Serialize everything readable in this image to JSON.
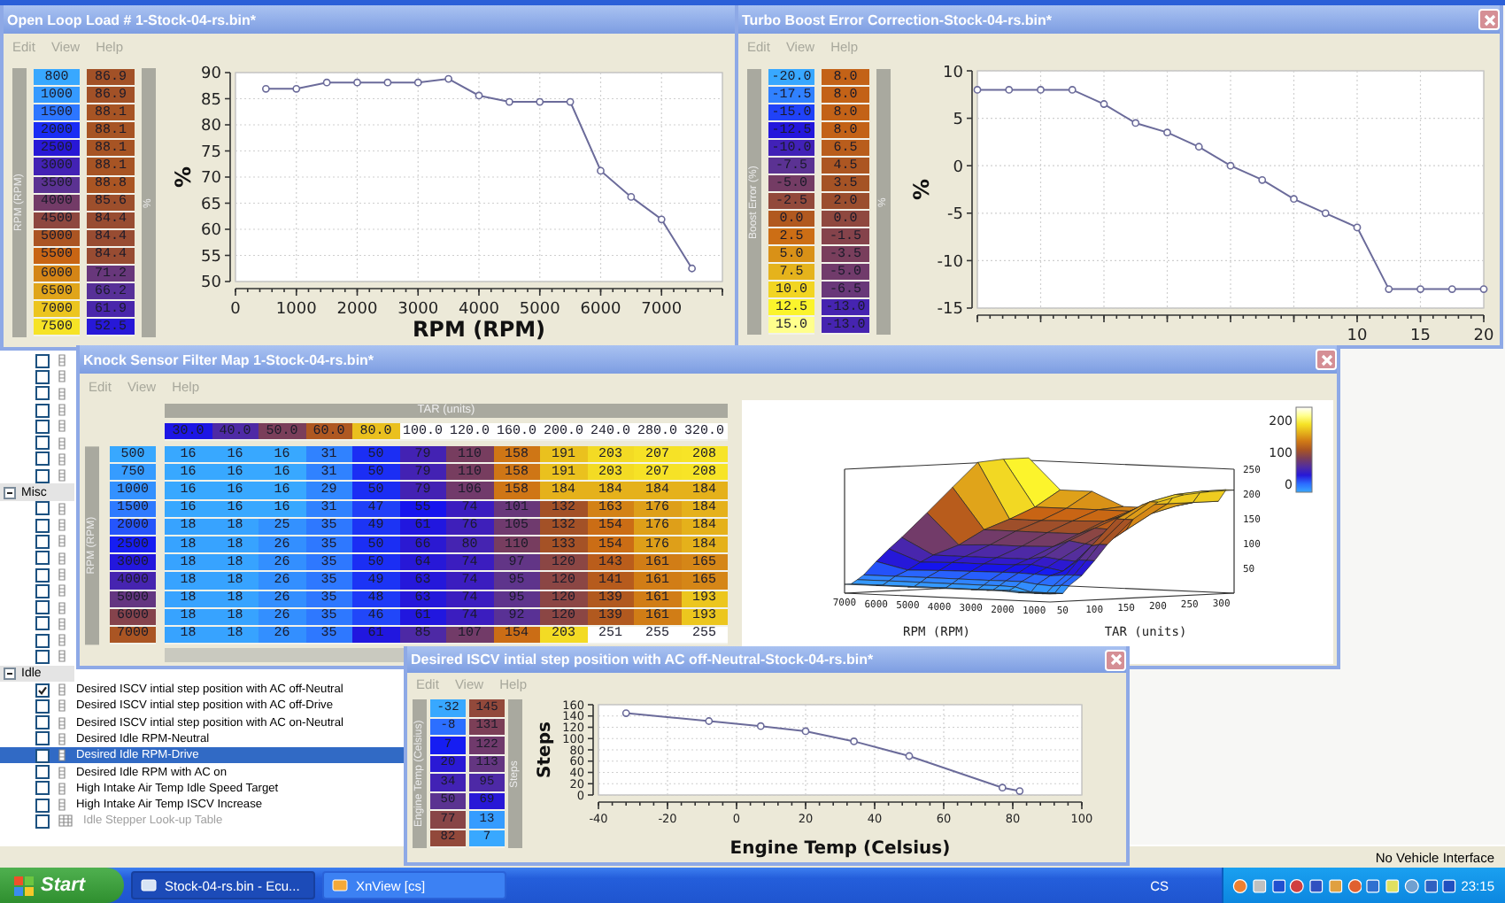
{
  "tree": [
    {
      "kind": "rows",
      "items": [
        {
          "kind": "curve",
          "checked": false
        },
        {
          "kind": "curve",
          "checked": false
        },
        {
          "kind": "curve",
          "checked": false
        },
        {
          "kind": "curve",
          "checked": false
        },
        {
          "kind": "curve",
          "checked": false
        },
        {
          "kind": "curve",
          "checked": false
        },
        {
          "kind": "curve",
          "checked": false
        },
        {
          "kind": "curve",
          "checked": false
        }
      ]
    },
    {
      "kind": "group",
      "label": "Misc",
      "expanded": true,
      "items": [
        {
          "kind": "curve",
          "checked": false
        },
        {
          "kind": "curve",
          "checked": false
        },
        {
          "kind": "curve",
          "checked": false
        },
        {
          "kind": "curve",
          "checked": false
        },
        {
          "kind": "curve",
          "checked": false
        },
        {
          "kind": "curve",
          "checked": false
        },
        {
          "kind": "curve",
          "checked": false
        },
        {
          "kind": "curve",
          "checked": false
        },
        {
          "kind": "curve",
          "checked": false
        },
        {
          "kind": "curve",
          "checked": false
        }
      ]
    },
    {
      "kind": "group",
      "label": "Idle",
      "expanded": true,
      "items": [
        {
          "kind": "curve",
          "label": "Desired ISCV intial step position with AC off-Neutral",
          "checked": true,
          "selected": false,
          "disabled": false
        },
        {
          "kind": "curve",
          "label": "Desired ISCV intial step position with AC off-Drive",
          "checked": false,
          "selected": false,
          "disabled": false
        },
        {
          "kind": "curve",
          "label": "Desired ISCV intial step position with AC on-Neutral",
          "checked": false,
          "selected": false,
          "disabled": false
        },
        {
          "kind": "curve",
          "label": "Desired Idle RPM-Neutral",
          "checked": false,
          "selected": false,
          "disabled": false
        },
        {
          "kind": "curve",
          "label": "Desired Idle RPM-Drive",
          "checked": false,
          "selected": true,
          "disabled": false
        },
        {
          "kind": "curve",
          "label": "Desired Idle RPM with AC on",
          "checked": false,
          "selected": false,
          "disabled": false
        },
        {
          "kind": "curve",
          "label": "High Intake Air Temp Idle Speed Target",
          "checked": false,
          "selected": false,
          "disabled": false
        },
        {
          "kind": "curve",
          "label": "High Intake Air Temp ISCV Increase",
          "checked": false,
          "selected": false,
          "disabled": false
        },
        {
          "kind": "map",
          "label": "Idle Stepper Look-up Table",
          "checked": false,
          "selected": false,
          "disabled": true
        }
      ]
    }
  ],
  "windows": [
    {
      "kind": "curve",
      "title": "Open Loop Load # 1-Stock-04-rs.bin*",
      "close_button": false,
      "menu": [
        {
          "label": "Edit",
          "disabled": true
        },
        {
          "label": "View",
          "disabled": true
        },
        {
          "label": "Help",
          "disabled": true
        }
      ],
      "axis_label": "RPM (RPM)",
      "value_label": "%",
      "rows": [
        {
          "axis": "800",
          "value": "86.9"
        },
        {
          "axis": "1000",
          "value": "86.9"
        },
        {
          "axis": "1500",
          "value": "88.1"
        },
        {
          "axis": "2000",
          "value": "88.1"
        },
        {
          "axis": "2500",
          "value": "88.1"
        },
        {
          "axis": "3000",
          "value": "88.1"
        },
        {
          "axis": "3500",
          "value": "88.8"
        },
        {
          "axis": "4000",
          "value": "85.6"
        },
        {
          "axis": "4500",
          "value": "84.4"
        },
        {
          "axis": "5000",
          "value": "84.4"
        },
        {
          "axis": "5500",
          "value": "84.4"
        },
        {
          "axis": "6000",
          "value": "71.2"
        },
        {
          "axis": "6500",
          "value": "66.2"
        },
        {
          "axis": "7000",
          "value": "61.9"
        },
        {
          "axis": "7500",
          "value": "52.5"
        }
      ],
      "chart_data": {
        "type": "line",
        "xlabel": "RPM (RPM)",
        "ylabel": "%",
        "x": [
          500,
          1000,
          1500,
          2000,
          2500,
          3000,
          3500,
          4000,
          4500,
          5000,
          5500,
          6000,
          6500,
          7000,
          7500
        ],
        "series": [
          {
            "color": "#6b6b9a",
            "marker": "circle",
            "values": [
              86.9,
              86.9,
              88.1,
              88.1,
              88.1,
              88.1,
              88.8,
              85.6,
              84.4,
              84.4,
              84.4,
              71.2,
              66.2,
              61.9,
              52.5
            ]
          }
        ],
        "grid": true,
        "xlim": [
          0,
          8000
        ],
        "ylim": [
          50,
          90
        ],
        "xticks": [
          {
            "value": 0,
            "label": "0"
          },
          {
            "value": 1000,
            "label": "1000"
          },
          {
            "value": 2000,
            "label": "2000"
          },
          {
            "value": 3000,
            "label": "3000"
          },
          {
            "value": 4000,
            "label": "4000"
          },
          {
            "value": 5000,
            "label": "5000"
          },
          {
            "value": 6000,
            "label": "6000"
          },
          {
            "value": 7000,
            "label": "7000"
          }
        ],
        "yticks": [
          {
            "value": 50,
            "label": "50"
          },
          {
            "value": 55,
            "label": "55"
          },
          {
            "value": 60,
            "label": "60"
          },
          {
            "value": 65,
            "label": "65"
          },
          {
            "value": 70,
            "label": "70"
          },
          {
            "value": 75,
            "label": "75"
          },
          {
            "value": 80,
            "label": "80"
          },
          {
            "value": 85,
            "label": "85"
          },
          {
            "value": 90,
            "label": "90"
          }
        ]
      }
    },
    {
      "kind": "curve",
      "title": "Turbo Boost Error Correction-Stock-04-rs.bin*",
      "close_button": true,
      "menu": [
        {
          "label": "Edit",
          "disabled": true
        },
        {
          "label": "View",
          "disabled": true
        },
        {
          "label": "Help",
          "disabled": true
        }
      ],
      "axis_label": "Boost Error (%)",
      "value_label": "%",
      "rows": [
        {
          "axis": "-20.0",
          "value": "8.0"
        },
        {
          "axis": "-17.5",
          "value": "8.0"
        },
        {
          "axis": "-15.0",
          "value": "8.0"
        },
        {
          "axis": "-12.5",
          "value": "8.0"
        },
        {
          "axis": "-10.0",
          "value": "6.5"
        },
        {
          "axis": "-7.5",
          "value": "4.5"
        },
        {
          "axis": "-5.0",
          "value": "3.5"
        },
        {
          "axis": "-2.5",
          "value": "2.0"
        },
        {
          "axis": "0.0",
          "value": "0.0"
        },
        {
          "axis": "2.5",
          "value": "-1.5"
        },
        {
          "axis": "5.0",
          "value": "-3.5"
        },
        {
          "axis": "7.5",
          "value": "-5.0"
        },
        {
          "axis": "10.0",
          "value": "-6.5"
        },
        {
          "axis": "12.5",
          "value": "-13.0"
        },
        {
          "axis": "15.0",
          "value": "-13.0"
        }
      ],
      "chart_data": {
        "type": "line",
        "ylabel": "%",
        "x": [
          -20,
          -17.5,
          -15,
          -12.5,
          -10,
          -7.5,
          -5,
          -2.5,
          0,
          2.5,
          5,
          7.5,
          10,
          12.5,
          15,
          17.5,
          20
        ],
        "series": [
          {
            "color": "#6b6b9a",
            "marker": "circle",
            "values": [
              8,
              8,
              8,
              8,
              6.5,
              4.5,
              3.5,
              2,
              0,
              -1.5,
              -3.5,
              -5,
              -6.5,
              -13,
              -13,
              -13,
              -13
            ]
          }
        ],
        "grid": true,
        "xlim": [
          -20,
          20
        ],
        "ylim": [
          -15,
          10
        ],
        "xticks": [
          {
            "value": 10,
            "label": "10"
          },
          {
            "value": 15,
            "label": "15"
          },
          {
            "value": 20,
            "label": "20"
          }
        ],
        "yticks": [
          {
            "value": -15,
            "label": "-15"
          },
          {
            "value": -10,
            "label": "-10"
          },
          {
            "value": -5,
            "label": "-5"
          },
          {
            "value": 0,
            "label": "0"
          },
          {
            "value": 5,
            "label": "5"
          },
          {
            "value": 10,
            "label": "10"
          }
        ]
      }
    },
    {
      "kind": "map",
      "title": "Knock Sensor Filter Map 1-Stock-04-rs.bin*",
      "close_button": true,
      "menu": [
        {
          "label": "Edit",
          "disabled": true
        },
        {
          "label": "View",
          "disabled": true
        },
        {
          "label": "Help",
          "disabled": true
        }
      ],
      "column_label": "TAR (units)",
      "row_label": "RPM (RPM)",
      "columns": [
        "30.0",
        "40.0",
        "50.0",
        "60.0",
        "80.0",
        "100.0",
        "120.0",
        "160.0",
        "200.0",
        "240.0",
        "280.0",
        "320.0"
      ],
      "rows": [
        {
          "axis": "500",
          "cells": [
            "16",
            "16",
            "16",
            "31",
            "50",
            "79",
            "110",
            "158",
            "191",
            "203",
            "207",
            "208"
          ]
        },
        {
          "axis": "750",
          "cells": [
            "16",
            "16",
            "16",
            "31",
            "50",
            "79",
            "110",
            "158",
            "191",
            "203",
            "207",
            "208"
          ]
        },
        {
          "axis": "1000",
          "cells": [
            "16",
            "16",
            "16",
            "29",
            "50",
            "79",
            "106",
            "158",
            "184",
            "184",
            "184",
            "184"
          ]
        },
        {
          "axis": "1500",
          "cells": [
            "16",
            "16",
            "16",
            "31",
            "47",
            "55",
            "74",
            "101",
            "132",
            "163",
            "176",
            "184"
          ]
        },
        {
          "axis": "2000",
          "cells": [
            "18",
            "18",
            "25",
            "35",
            "49",
            "61",
            "76",
            "105",
            "132",
            "154",
            "176",
            "184"
          ]
        },
        {
          "axis": "2500",
          "cells": [
            "18",
            "18",
            "26",
            "35",
            "50",
            "66",
            "80",
            "110",
            "133",
            "154",
            "176",
            "184"
          ]
        },
        {
          "axis": "3000",
          "cells": [
            "18",
            "18",
            "26",
            "35",
            "50",
            "64",
            "74",
            "97",
            "120",
            "143",
            "161",
            "165"
          ]
        },
        {
          "axis": "4000",
          "cells": [
            "18",
            "18",
            "26",
            "35",
            "49",
            "63",
            "74",
            "95",
            "120",
            "141",
            "161",
            "165"
          ]
        },
        {
          "axis": "5000",
          "cells": [
            "18",
            "18",
            "26",
            "35",
            "48",
            "63",
            "74",
            "95",
            "120",
            "139",
            "161",
            "193"
          ]
        },
        {
          "axis": "6000",
          "cells": [
            "18",
            "18",
            "26",
            "35",
            "46",
            "61",
            "74",
            "92",
            "120",
            "139",
            "161",
            "193"
          ]
        },
        {
          "axis": "7000",
          "cells": [
            "18",
            "18",
            "26",
            "35",
            "61",
            "85",
            "107",
            "154",
            "203",
            "251",
            "255",
            "255"
          ]
        }
      ],
      "surface_plot": {
        "xlabel": "RPM (RPM)",
        "ylabel": "TAR (units)",
        "x_ticks": [
          "7000",
          "6000",
          "5000",
          "4000",
          "3000",
          "2000",
          "1000"
        ],
        "y_ticks": [
          "50",
          "100",
          "150",
          "200",
          "250",
          "300"
        ],
        "z_ticks": [
          "250",
          "200",
          "150",
          "100",
          "50"
        ],
        "colorbar_ticks": [
          "200",
          "100",
          "0"
        ]
      }
    },
    {
      "kind": "curve",
      "title": "Desired ISCV intial step position with AC off-Neutral-Stock-04-rs.bin*",
      "close_button": true,
      "menu": [
        {
          "label": "Edit",
          "disabled": true
        },
        {
          "label": "View",
          "disabled": true
        },
        {
          "label": "Help",
          "disabled": true
        }
      ],
      "axis_label": "Engine Temp (Celsius)",
      "value_label": "Steps",
      "rows": [
        {
          "axis": "-32",
          "value": "145"
        },
        {
          "axis": "-8",
          "value": "131"
        },
        {
          "axis": "7",
          "value": "122"
        },
        {
          "axis": "20",
          "value": "113"
        },
        {
          "axis": "34",
          "value": "95"
        },
        {
          "axis": "50",
          "value": "69"
        },
        {
          "axis": "77",
          "value": "13"
        },
        {
          "axis": "82",
          "value": "7"
        }
      ],
      "chart_data": {
        "type": "line",
        "xlabel": "Engine Temp (Celsius)",
        "ylabel": "Steps",
        "x": [
          -32,
          -8,
          7,
          20,
          34,
          50,
          77,
          82
        ],
        "series": [
          {
            "color": "#6b6b9a",
            "marker": "circle",
            "values": [
              145,
              131,
              122,
              113,
              95,
              69,
              13,
              7
            ]
          }
        ],
        "grid": true,
        "xlim": [
          -40,
          100
        ],
        "ylim": [
          0,
          160
        ],
        "xticks": [
          {
            "value": -40,
            "label": "-40"
          },
          {
            "value": -20,
            "label": "-20"
          },
          {
            "value": 0,
            "label": "0"
          },
          {
            "value": 20,
            "label": "20"
          },
          {
            "value": 40,
            "label": "40"
          },
          {
            "value": 60,
            "label": "60"
          },
          {
            "value": 80,
            "label": "80"
          },
          {
            "value": 100,
            "label": "100"
          }
        ],
        "yticks": [
          {
            "value": 0,
            "label": "0"
          },
          {
            "value": 20,
            "label": "20"
          },
          {
            "value": 40,
            "label": "40"
          },
          {
            "value": 60,
            "label": "60"
          },
          {
            "value": 80,
            "label": "80"
          },
          {
            "value": 100,
            "label": "100"
          },
          {
            "value": 120,
            "label": "120"
          },
          {
            "value": 140,
            "label": "140"
          },
          {
            "value": 160,
            "label": "160"
          }
        ]
      }
    }
  ],
  "status_bar": {
    "text": "No Vehicle Interface"
  },
  "taskbar": {
    "start": "Start",
    "tasks": [
      {
        "label": "Stock-04-rs.bin - Ecu...",
        "selected": true
      },
      {
        "label": "XnView [cs]",
        "selected": false
      }
    ],
    "language": "CS",
    "clock": "23:15"
  }
}
